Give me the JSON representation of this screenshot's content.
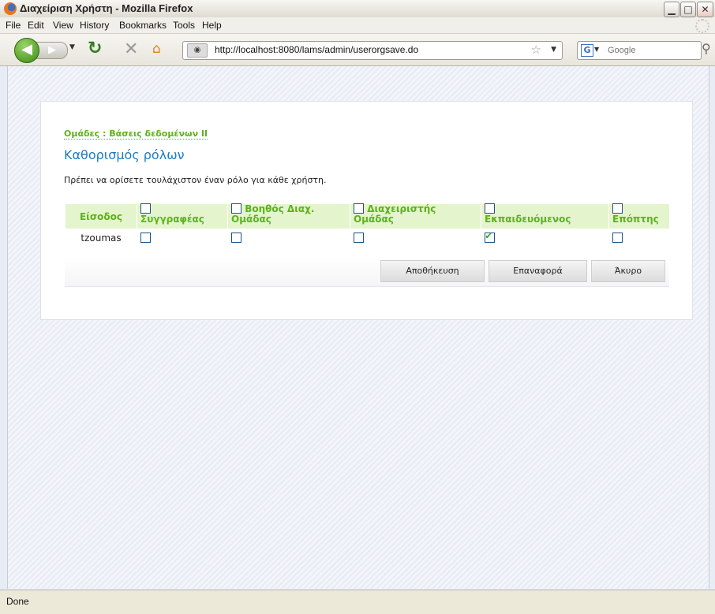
{
  "window": {
    "title": "Διαχείριση Χρήστη - Mozilla Firefox",
    "minimize_glyph": "▁",
    "maximize_glyph": "□",
    "close_glyph": "✕"
  },
  "menu": {
    "file": "File",
    "edit": "Edit",
    "view": "View",
    "history": "History",
    "bookmarks": "Bookmarks",
    "tools": "Tools",
    "help": "Help"
  },
  "navigation": {
    "url": "http://localhost:8080/lams/admin/userorgsave.do",
    "search_placeholder": "Google",
    "search_engine_letter": "G"
  },
  "page": {
    "breadcrumb": "Ομάδες : Βάσεις δεδομένων II",
    "title": "Καθορισμός ρόλων",
    "instruction": "Πρέπει να ορίσετε τουλάχιστον έναν ρόλο για κάθε χρήστη."
  },
  "table": {
    "login_header": "Είσοδος",
    "roles": [
      {
        "label": "Συγγραφέας"
      },
      {
        "label": "Βοηθός Διαχ. Ομάδας"
      },
      {
        "label": "Διαχειριστής Ομάδας"
      },
      {
        "label": "Εκπαιδευόμενος"
      },
      {
        "label": "Επόπτης"
      }
    ],
    "rows": [
      {
        "login": "tzoumas",
        "checked": [
          false,
          false,
          false,
          true,
          false
        ]
      }
    ]
  },
  "buttons": {
    "save": "Αποθήκευση",
    "reset": "Επαναφορά",
    "cancel": "Άκυρο"
  },
  "status": {
    "text": "Done"
  },
  "colors": {
    "accent_blue": "#1a7cc5",
    "header_green": "#5cb21a",
    "header_bg": "#e4f5cd"
  },
  "icons": [
    "firefox-logo-icon",
    "back-arrow-icon",
    "forward-arrow-icon",
    "reload-icon",
    "stop-icon",
    "home-icon",
    "site-identity-icon",
    "bookmark-star-icon",
    "google-search-icon",
    "magnifier-icon"
  ]
}
